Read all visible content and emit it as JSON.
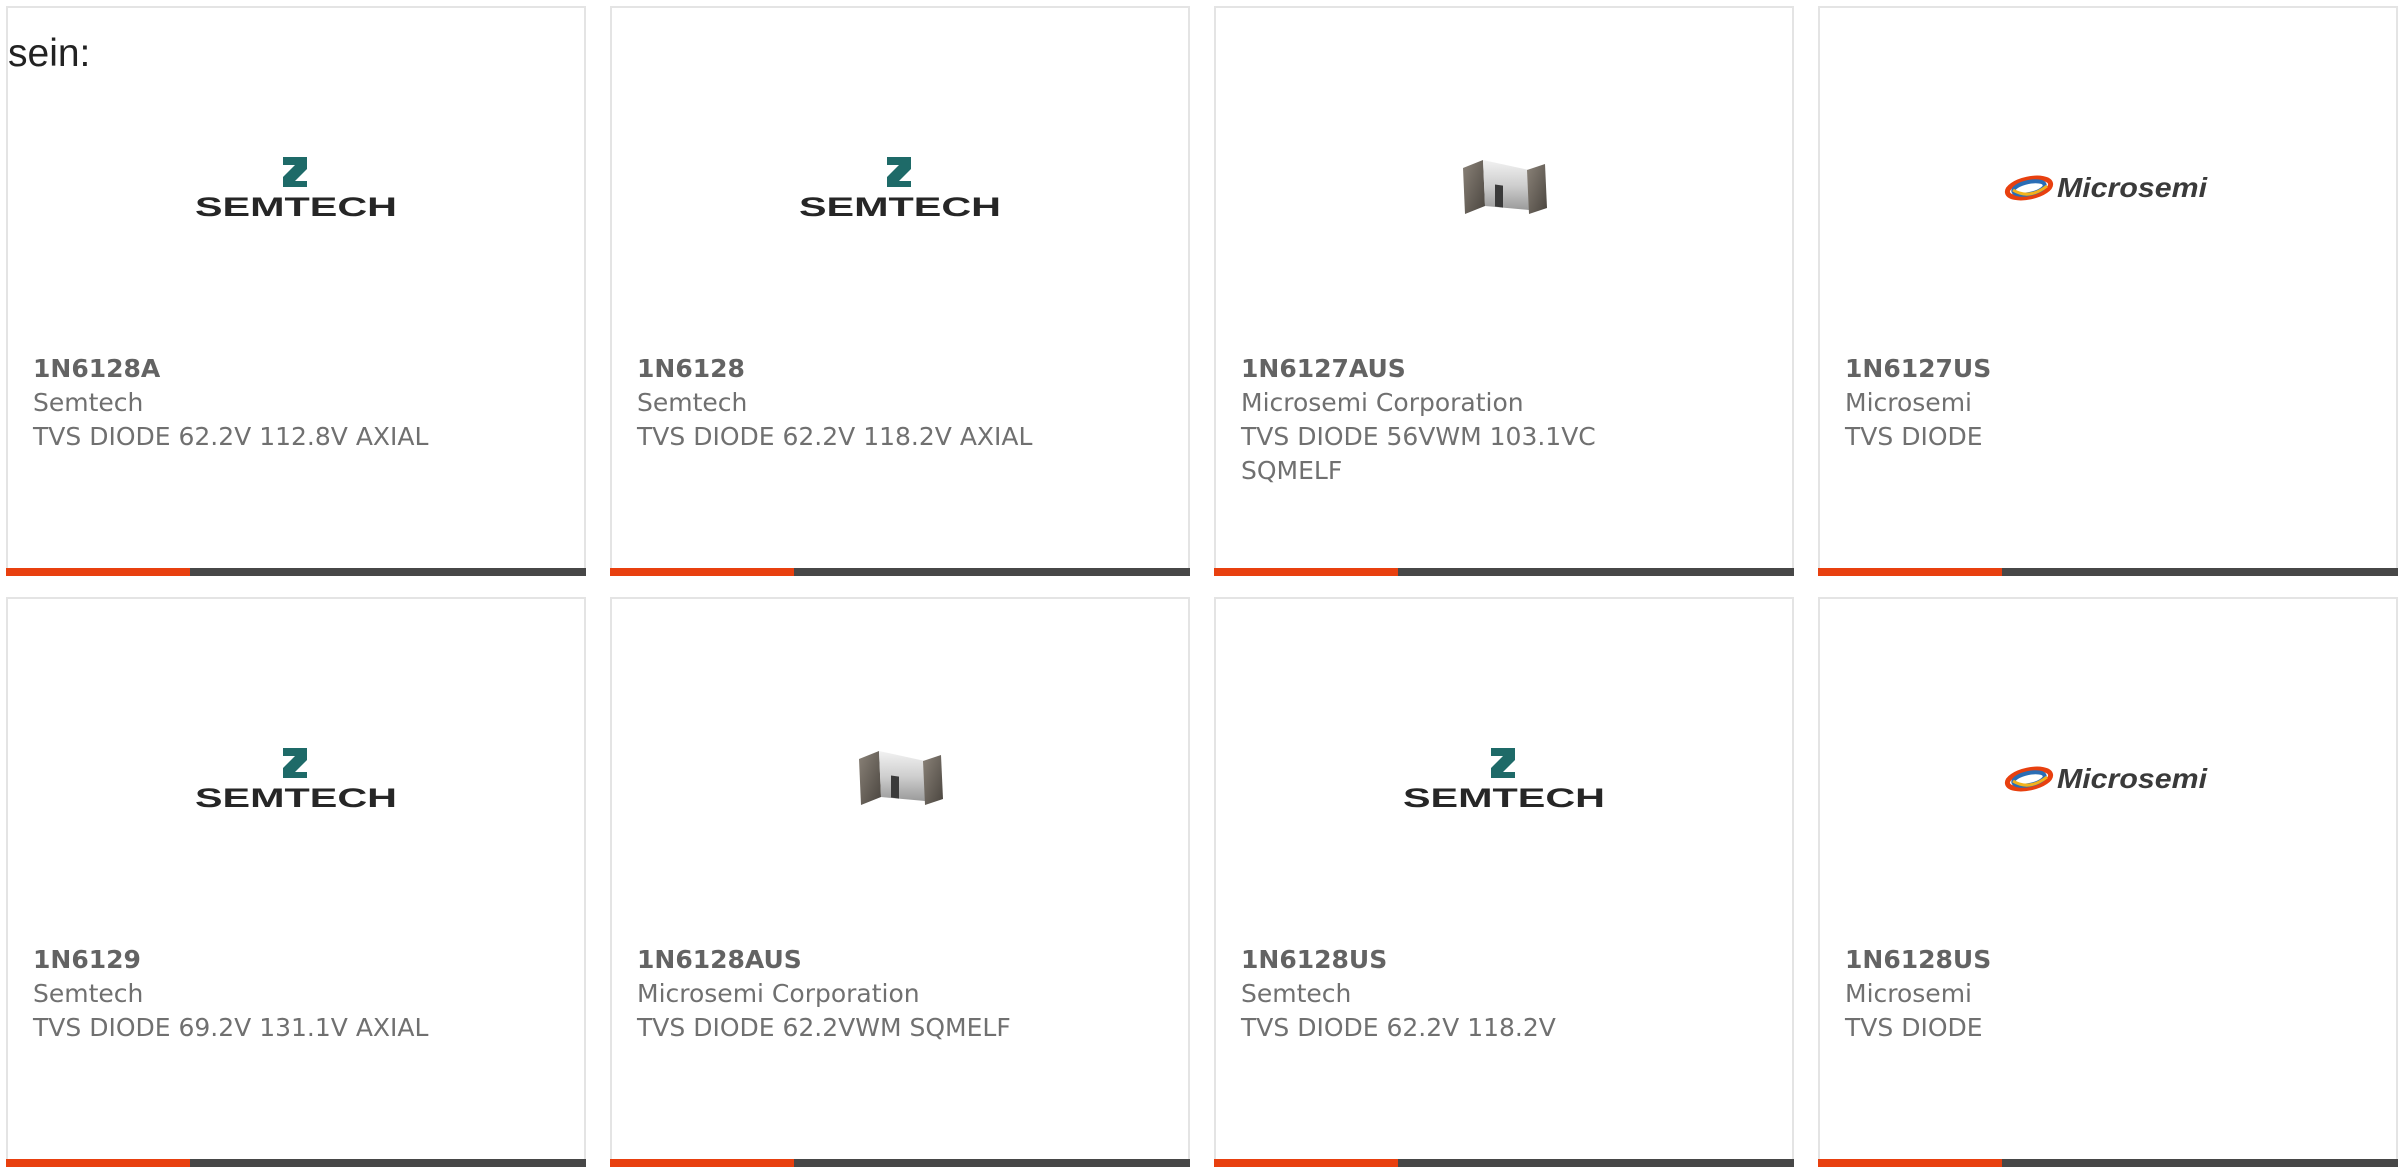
{
  "heading": "sein:",
  "colors": {
    "accent": "#e8400f",
    "bar_dark": "#474747",
    "card_border": "#e4e4e4",
    "text": "#707070"
  },
  "products": [
    {
      "part": "1N6128A",
      "manufacturer": "Semtech",
      "description": "TVS DIODE 62.2V 112.8V AXIAL",
      "image": "semtech-logo"
    },
    {
      "part": "1N6128",
      "manufacturer": "Semtech",
      "description": "TVS DIODE 62.2V 118.2V AXIAL",
      "image": "semtech-logo"
    },
    {
      "part": "1N6127AUS",
      "manufacturer": "Microsemi Corporation",
      "description": "TVS DIODE 56VWM 103.1VC SQMELF",
      "image": "sqmelf-diode-photo"
    },
    {
      "part": "1N6127US",
      "manufacturer": "Microsemi",
      "description": "TVS DIODE",
      "image": "microsemi-logo"
    },
    {
      "part": "1N6129",
      "manufacturer": "Semtech",
      "description": "TVS DIODE 69.2V 131.1V AXIAL",
      "image": "semtech-logo"
    },
    {
      "part": "1N6128AUS",
      "manufacturer": "Microsemi Corporation",
      "description": "TVS DIODE 62.2VWM SQMELF",
      "image": "sqmelf-diode-photo"
    },
    {
      "part": "1N6128US",
      "manufacturer": "Semtech",
      "description": "TVS DIODE 62.2V 118.2V",
      "image": "semtech-logo"
    },
    {
      "part": "1N6128US",
      "manufacturer": "Microsemi",
      "description": "TVS DIODE",
      "image": "microsemi-logo"
    }
  ]
}
